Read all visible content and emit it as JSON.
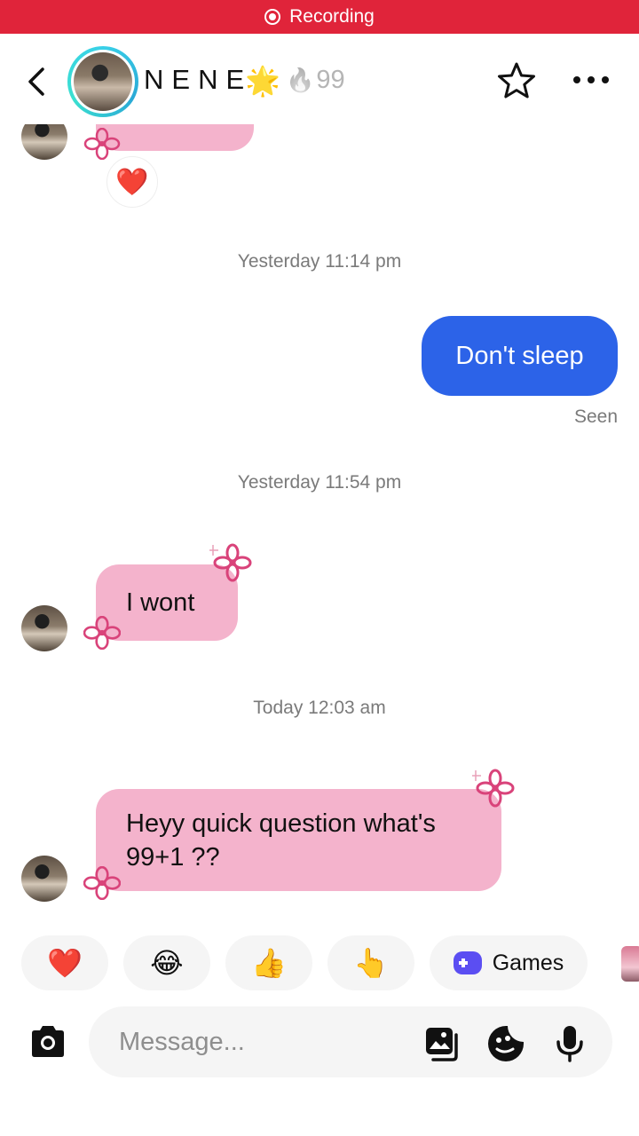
{
  "recording": {
    "label": "Recording"
  },
  "header": {
    "name": "NENE",
    "name_star": "🌟",
    "streak_icon": "fire-icon",
    "streak_count": "99"
  },
  "messages": {
    "ts1": "Yesterday 11:14 pm",
    "sent1": "Don't sleep",
    "seen": "Seen",
    "ts2": "Yesterday 11:54 pm",
    "recv1": "I wont",
    "ts3": "Today 12:03 am",
    "recv2_line1": "Heyy quick question what's",
    "recv2_line2": "99+1 ??",
    "reaction": "❤️"
  },
  "quick_reactions": {
    "heart": "❤️",
    "laugh": "😂",
    "thumbs": "👍",
    "point": "👆",
    "games_label": "Games"
  },
  "composer": {
    "placeholder": "Message..."
  },
  "colors": {
    "recording_bar": "#e0243a",
    "sent_bubble": "#2c63e8",
    "received_bubble": "#f4b3cc",
    "flower": "#d9437a"
  }
}
